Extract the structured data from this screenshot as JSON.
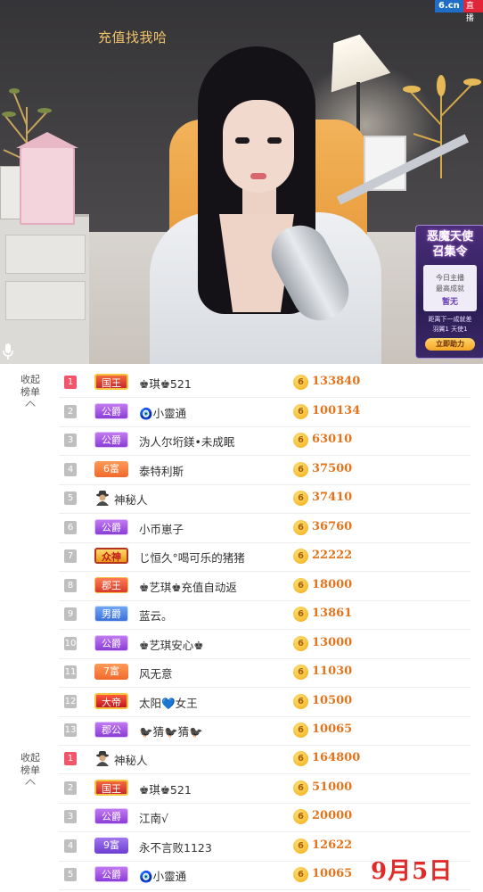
{
  "video": {
    "site_logo": "6.cn",
    "live_tag": "直播",
    "recharge_tip": "充值找我哈",
    "promo": {
      "title_line1": "恶魔天使",
      "title_line2": "召集令",
      "card_line1": "今日主播",
      "card_line2": "最高成就",
      "card_line3": "暂无",
      "distance_line1": "距离下一成就差",
      "distance_line2": "羽翼1 天使1",
      "button_label": "立即助力"
    }
  },
  "ranking_lists": [
    {
      "collapse_label_1": "收起",
      "collapse_label_2": "榜单",
      "rows": [
        {
          "rank": "1",
          "badge_text": "国王",
          "badge_type": "king",
          "name": "♚琪♚521",
          "score": "133840"
        },
        {
          "rank": "2",
          "badge_text": "公爵",
          "badge_type": "duke",
          "name": "🧿小靈通",
          "score": "100134"
        },
        {
          "rank": "3",
          "badge_text": "公爵",
          "badge_type": "duke",
          "name": "沩人尔垳鎂•未成眠",
          "score": "63010"
        },
        {
          "rank": "4",
          "badge_text": "6富",
          "badge_type": "rich",
          "name": "泰特利斯",
          "score": "37500"
        },
        {
          "rank": "5",
          "badge_text": "",
          "badge_type": "agent",
          "name": "神秘人",
          "score": "37410"
        },
        {
          "rank": "6",
          "badge_text": "公爵",
          "badge_type": "duke",
          "name": "小币崽子",
          "score": "36760"
        },
        {
          "rank": "7",
          "badge_text": "众神",
          "badge_type": "god",
          "name": "じ恒久°喝可乐的猪猪",
          "score": "22222"
        },
        {
          "rank": "8",
          "badge_text": "郡王",
          "badge_type": "count",
          "name": "♚艺琪♚充值自动返",
          "score": "18000"
        },
        {
          "rank": "9",
          "badge_text": "男爵",
          "badge_type": "baron",
          "name": "蓝云。",
          "score": "13861"
        },
        {
          "rank": "10",
          "badge_text": "公爵",
          "badge_type": "duke",
          "name": "♚艺琪安心♚",
          "score": "13000"
        },
        {
          "rank": "11",
          "badge_text": "7富",
          "badge_type": "rich",
          "name": "风无意",
          "score": "11030"
        },
        {
          "rank": "12",
          "badge_text": "大帝",
          "badge_type": "emperor",
          "name": "太阳💙女王",
          "score": "10500"
        },
        {
          "rank": "13",
          "badge_text": "郡公",
          "badge_type": "duke",
          "name": "🐦‍⬛猜🐦‍⬛猜🐦‍⬛",
          "score": "10065"
        }
      ]
    },
    {
      "collapse_label_1": "收起",
      "collapse_label_2": "榜单",
      "rows": [
        {
          "rank": "1",
          "badge_text": "",
          "badge_type": "agent",
          "name": "神秘人",
          "score": "164800"
        },
        {
          "rank": "2",
          "badge_text": "国王",
          "badge_type": "king",
          "name": "♚琪♚521",
          "score": "51000"
        },
        {
          "rank": "3",
          "badge_text": "公爵",
          "badge_type": "duke",
          "name": "江南√",
          "score": "20000"
        },
        {
          "rank": "4",
          "badge_text": "9富",
          "badge_type": "ninerich",
          "name": "永不言败1123",
          "score": "12622"
        },
        {
          "rank": "5",
          "badge_text": "公爵",
          "badge_type": "duke",
          "name": "🧿小靈通",
          "score": "10065"
        }
      ]
    }
  ],
  "coin_symbol": "6",
  "date_stamp": "9月5日",
  "colors": {
    "score": "#e4741c",
    "rank1": "#f2566b",
    "rank_default": "#bfbfbf",
    "date": "#e02b2b"
  }
}
